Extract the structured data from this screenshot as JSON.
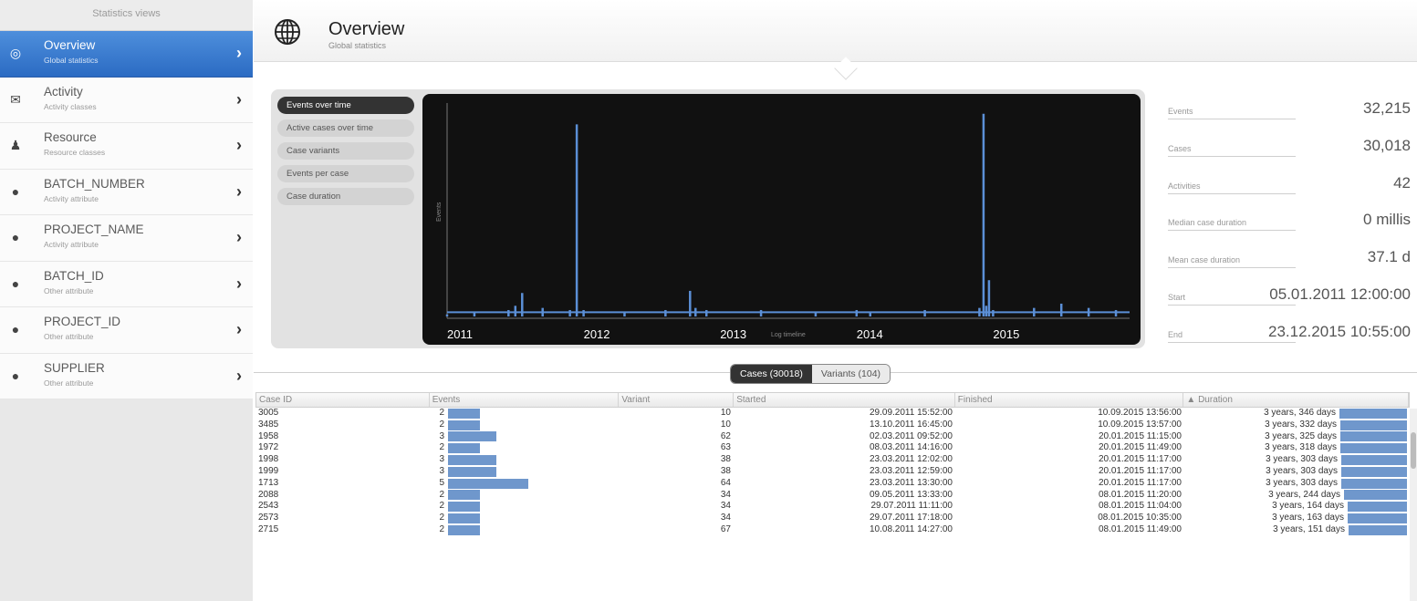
{
  "sidebar": {
    "header": "Statistics views",
    "items": [
      {
        "title": "Overview",
        "subtitle": "Global statistics",
        "icon": "globe-icon",
        "active": true
      },
      {
        "title": "Activity",
        "subtitle": "Activity classes",
        "icon": "envelope-icon",
        "active": false
      },
      {
        "title": "Resource",
        "subtitle": "Resource classes",
        "icon": "people-icon",
        "active": false
      },
      {
        "title": "BATCH_NUMBER",
        "subtitle": "Activity attribute",
        "icon": "speech-bubble-icon",
        "active": false
      },
      {
        "title": "PROJECT_NAME",
        "subtitle": "Activity attribute",
        "icon": "speech-bubble-icon",
        "active": false
      },
      {
        "title": "BATCH_ID",
        "subtitle": "Other attribute",
        "icon": "speech-bubble-icon",
        "active": false
      },
      {
        "title": "PROJECT_ID",
        "subtitle": "Other attribute",
        "icon": "speech-bubble-icon",
        "active": false
      },
      {
        "title": "SUPPLIER",
        "subtitle": "Other attribute",
        "icon": "speech-bubble-icon",
        "active": false
      }
    ]
  },
  "header": {
    "title": "Overview",
    "subtitle": "Global statistics",
    "icon": "globe-icon"
  },
  "chart_tabs": [
    {
      "label": "Events over time",
      "active": true
    },
    {
      "label": "Active cases over time",
      "active": false
    },
    {
      "label": "Case variants",
      "active": false
    },
    {
      "label": "Events per case",
      "active": false
    },
    {
      "label": "Case duration",
      "active": false
    }
  ],
  "chart_data": {
    "type": "line",
    "background": "#111111",
    "line_color": "#5b8fd6",
    "ylabel": "Events",
    "xlabel": "Log timeline",
    "x_ticks": [
      "2011",
      "2012",
      "2013",
      "2014",
      "2015"
    ],
    "x_range": [
      2011.0,
      2016.0
    ],
    "ylim": [
      0,
      100
    ],
    "baseline": 2,
    "x": [
      2011.0,
      2011.2,
      2011.45,
      2011.5,
      2011.55,
      2011.7,
      2011.9,
      2011.95,
      2012.0,
      2012.3,
      2012.6,
      2012.78,
      2012.82,
      2012.9,
      2013.3,
      2013.7,
      2014.0,
      2014.1,
      2014.5,
      2014.9,
      2014.93,
      2014.95,
      2014.97,
      2015.0,
      2015.3,
      2015.5,
      2015.7,
      2015.9
    ],
    "y": [
      1,
      2,
      3,
      5,
      11,
      4,
      3,
      90,
      3,
      2,
      3,
      12,
      4,
      3,
      3,
      2,
      3,
      2,
      3,
      4,
      95,
      5,
      17,
      3,
      4,
      6,
      4,
      3
    ]
  },
  "stats": [
    {
      "label": "Events",
      "value": "32,215"
    },
    {
      "label": "Cases",
      "value": "30,018"
    },
    {
      "label": "Activities",
      "value": "42"
    },
    {
      "label": "Median case duration",
      "value": "0 millis"
    },
    {
      "label": "Mean case duration",
      "value": "37.1 d"
    },
    {
      "label": "Start",
      "value": "05.01.2011 12:00:00"
    },
    {
      "label": "End",
      "value": "23.12.2015 10:55:00"
    }
  ],
  "table_toggle": {
    "cases_label": "Cases (30018)",
    "variants_label": "Variants (104)"
  },
  "table": {
    "columns": [
      "Case ID",
      "Events",
      "Variant",
      "Started",
      "Finished",
      "▲ Duration"
    ],
    "rows": [
      {
        "id": "3005",
        "events": "2",
        "events_value": 2,
        "variant": "10",
        "started": "29.09.2011 15:52:00",
        "finished": "10.09.2015 13:56:00",
        "duration": "3 years, 346 days",
        "duration_days": 1441
      },
      {
        "id": "3485",
        "events": "2",
        "events_value": 2,
        "variant": "10",
        "started": "13.10.2011 16:45:00",
        "finished": "10.09.2015 13:57:00",
        "duration": "3 years, 332 days",
        "duration_days": 1427
      },
      {
        "id": "1958",
        "events": "3",
        "events_value": 3,
        "variant": "62",
        "started": "02.03.2011 09:52:00",
        "finished": "20.01.2015 11:15:00",
        "duration": "3 years, 325 days",
        "duration_days": 1420
      },
      {
        "id": "1972",
        "events": "2",
        "events_value": 2,
        "variant": "63",
        "started": "08.03.2011 14:16:00",
        "finished": "20.01.2015 11:49:00",
        "duration": "3 years, 318 days",
        "duration_days": 1413
      },
      {
        "id": "1998",
        "events": "3",
        "events_value": 3,
        "variant": "38",
        "started": "23.03.2011 12:02:00",
        "finished": "20.01.2015 11:17:00",
        "duration": "3 years, 303 days",
        "duration_days": 1398
      },
      {
        "id": "1999",
        "events": "3",
        "events_value": 3,
        "variant": "38",
        "started": "23.03.2011 12:59:00",
        "finished": "20.01.2015 11:17:00",
        "duration": "3 years, 303 days",
        "duration_days": 1398
      },
      {
        "id": "1713",
        "events": "5",
        "events_value": 5,
        "variant": "64",
        "started": "23.03.2011 13:30:00",
        "finished": "20.01.2015 11:17:00",
        "duration": "3 years, 303 days",
        "duration_days": 1398
      },
      {
        "id": "2088",
        "events": "2",
        "events_value": 2,
        "variant": "34",
        "started": "09.05.2011 13:33:00",
        "finished": "08.01.2015 11:20:00",
        "duration": "3 years, 244 days",
        "duration_days": 1339
      },
      {
        "id": "2543",
        "events": "2",
        "events_value": 2,
        "variant": "34",
        "started": "29.07.2011 11:11:00",
        "finished": "08.01.2015 11:04:00",
        "duration": "3 years, 164 days",
        "duration_days": 1259
      },
      {
        "id": "2573",
        "events": "2",
        "events_value": 2,
        "variant": "34",
        "started": "29.07.2011 17:18:00",
        "finished": "08.01.2015 10:35:00",
        "duration": "3 years, 163 days",
        "duration_days": 1258
      },
      {
        "id": "2715",
        "events": "2",
        "events_value": 2,
        "variant": "67",
        "started": "10.08.2011 14:27:00",
        "finished": "08.01.2015 11:49:00",
        "duration": "3 years, 151 days",
        "duration_days": 1246
      }
    ]
  }
}
